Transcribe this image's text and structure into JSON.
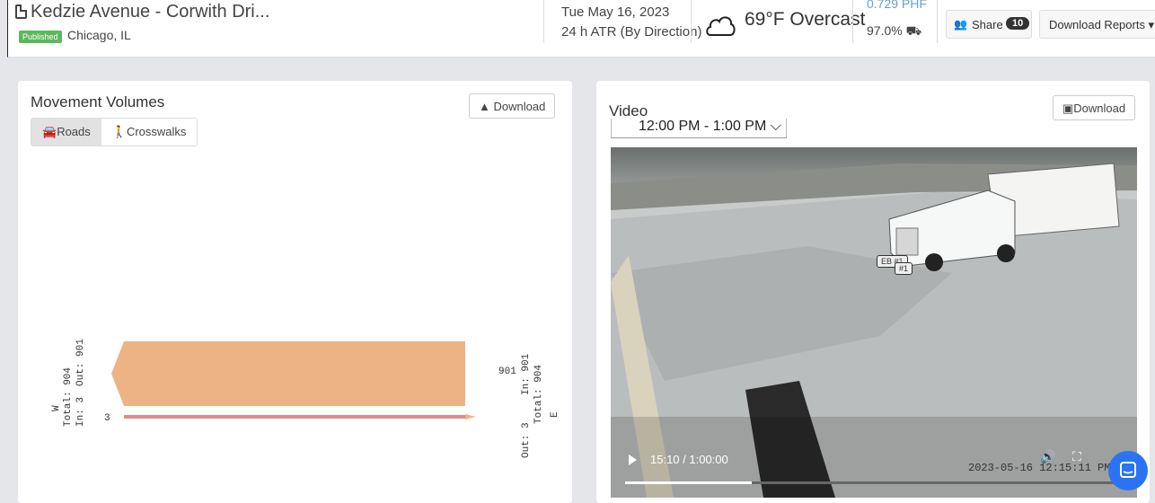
{
  "header": {
    "title": "Kedzie Avenue - Corwith Dri...",
    "status_badge": "Published",
    "location": "Chicago, IL",
    "date": "Tue May 16, 2023",
    "study_type": "24 h ATR (By Direction)",
    "weather": "69°F Overcast",
    "phf": "0.729 PHF",
    "heavy_pct": "97.0%",
    "share_label": "Share",
    "share_count": "10",
    "reports_label": "Download Reports ▾"
  },
  "movement_volumes": {
    "title": "Movement Volumes",
    "download_label": "Download",
    "tabs": [
      {
        "label": "Roads",
        "active": true
      },
      {
        "label": "Crosswalks",
        "active": false
      }
    ]
  },
  "chart_data": {
    "type": "flow",
    "directions": [
      {
        "id": "W",
        "total_label": "Total: 904",
        "in_label": "In: 3",
        "out_label": "Out: 901"
      },
      {
        "id": "E",
        "total_label": "Total: 904",
        "in_label": "In: 901",
        "out_label": "Out: 3"
      }
    ],
    "flows": [
      {
        "from": "E",
        "to": "W",
        "value": 901,
        "color": "#eeb385"
      },
      {
        "from": "W",
        "to": "E",
        "value": 3,
        "color": "#e08a8a"
      }
    ]
  },
  "video": {
    "title": "Video",
    "download_label": "Download",
    "time_range": "12:00 PM - 1:00 PM",
    "playback_time": "15:10 / 1:00:00",
    "progress": 0.2528,
    "timestamp": "2023-05-16 12:15:11 PM",
    "tag_primary": "EB #1",
    "tag_secondary": "#1"
  },
  "colors": {
    "accent": "#2a73f5",
    "published": "#5cb85c",
    "phf_text": "#6a9fd8"
  }
}
